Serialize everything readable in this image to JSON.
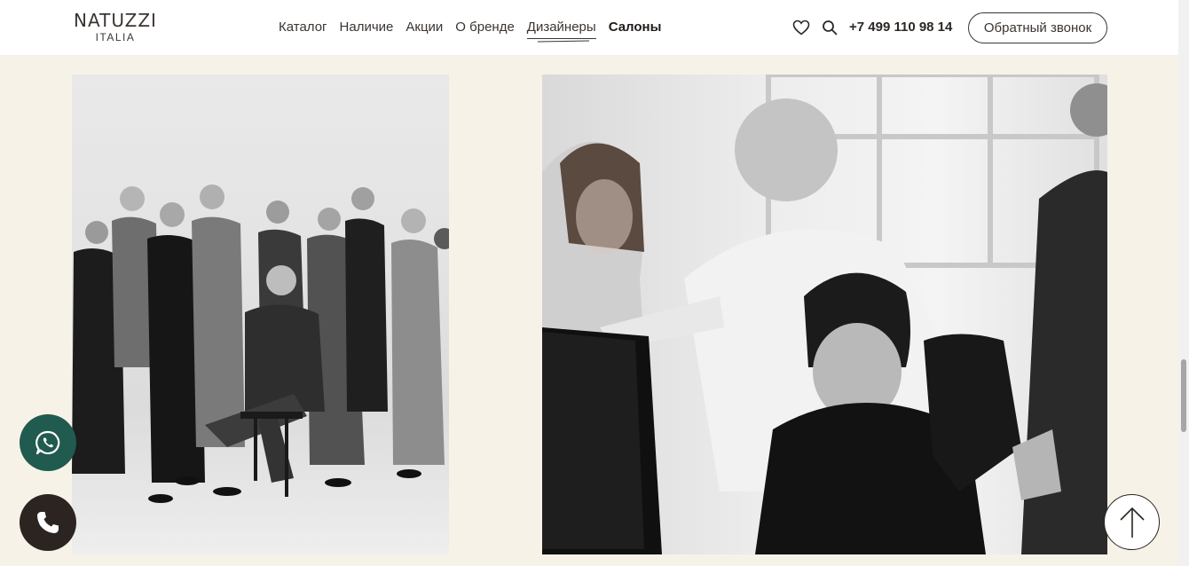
{
  "header": {
    "logo": {
      "main": "NATUZZI",
      "sub": "ITALIA"
    },
    "nav": [
      {
        "label": "Каталог"
      },
      {
        "label": "Наличие"
      },
      {
        "label": "Акции"
      },
      {
        "label": "О бренде"
      },
      {
        "label": "Дизайнеры"
      },
      {
        "label": "Салоны"
      }
    ],
    "phone": "+7 499 110 98 14",
    "callback_label": "Обратный звонок",
    "icons": {
      "favorites": "heart-icon",
      "search": "search-icon"
    }
  },
  "floating": {
    "whatsapp": "whatsapp-icon",
    "call": "phone-icon",
    "scroll_top": "arrow-up-icon"
  },
  "colors": {
    "background": "#f7f2e8",
    "header": "#ffffff",
    "whatsapp": "#215a4f",
    "call": "#2b2420"
  }
}
